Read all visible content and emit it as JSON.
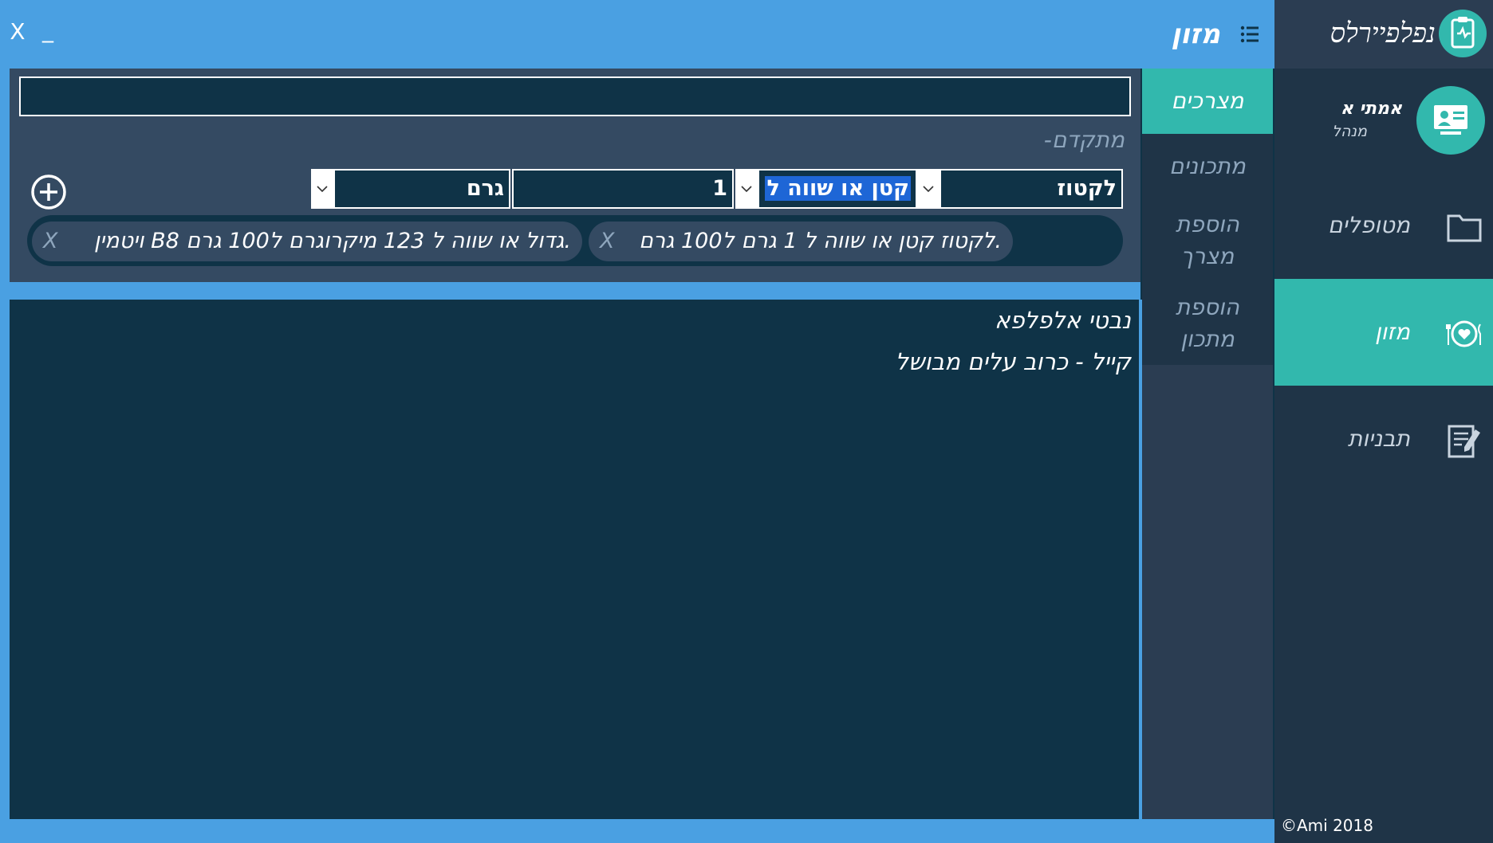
{
  "window": {
    "close_label": "X",
    "minimize_label": "_",
    "title": "מזון"
  },
  "brand": {
    "logo_text": "נפלפיירלס",
    "icon": "clipboard-heart-icon"
  },
  "user": {
    "name": "אמתי א",
    "role": "מנהל",
    "icon": "presentation-user-icon"
  },
  "nav": {
    "items": [
      {
        "label": "מטופלים",
        "icon": "folder-icon",
        "active": false
      },
      {
        "label": "מזון",
        "icon": "plate-heart-icon",
        "active": true
      },
      {
        "label": "תבניות",
        "icon": "notepad-icon",
        "active": false
      }
    ]
  },
  "tabs": {
    "products": "מצרכים",
    "recipes": "מתכונים",
    "add_product_1": "הוספת",
    "add_product_2": "מצרך",
    "add_recipe_1": "הוספת",
    "add_recipe_2": "מתכון"
  },
  "search": {
    "value": "",
    "placeholder": ""
  },
  "advanced_label": "-מתקדם",
  "filter": {
    "field": "לקטוז",
    "operator": "קטן או שווה ל",
    "value": "1",
    "unit": "גרם"
  },
  "active_filters": [
    {
      "text": "לקטוז קטן או שווה ל 1 גרם ל100 גרם.",
      "remove_label": "X"
    },
    {
      "text": "ויטמין B8 גדול או שווה ל 123 מיקרוגרם ל100 גרם.",
      "remove_label": "X"
    }
  ],
  "results": [
    "נבטי אלפלפא",
    "קייל - כרוב עלים מבושל"
  ],
  "footer": {
    "copyright": "©Ami 2018"
  },
  "colors": {
    "accent": "#32b8ad",
    "titlebar": "#4aa0e2",
    "nav_bg": "#1f3447",
    "panel_bg": "#344a62",
    "content_bg": "#0f3347",
    "selection": "#1e66d6"
  }
}
